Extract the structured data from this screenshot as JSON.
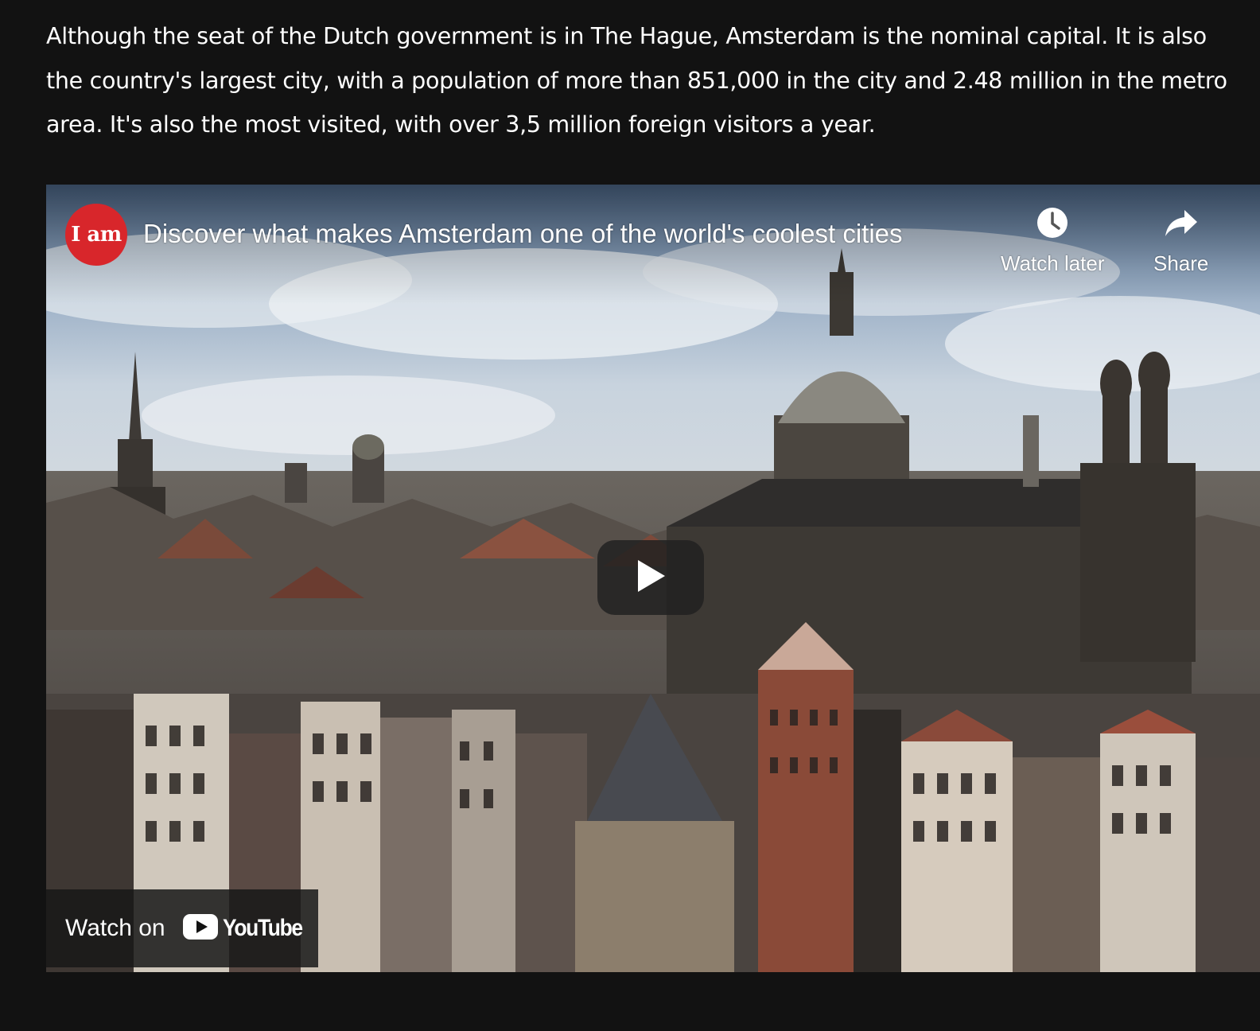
{
  "article": {
    "paragraph": "Although the seat of the Dutch government is in The Hague, Amsterdam is the nominal capital. It is also the country's largest city, with a population of more than 851,000 in the city and 2.48 million in the metro area. It's also the most visited, with over 3,5 million foreign visitors a year."
  },
  "video": {
    "channel_avatar_text": "I am",
    "title": "Discover what makes Amsterdam one of the world's coolest cities",
    "watch_later_label": "Watch later",
    "share_label": "Share",
    "watch_on_label": "Watch on",
    "youtube_wordmark": "YouTube",
    "icons": {
      "watch_later": "clock-icon",
      "share": "share-arrow-icon",
      "play": "play-icon",
      "youtube": "youtube-logo-icon"
    },
    "colors": {
      "avatar_bg": "#d8262b",
      "youtube_red": "#ffffff",
      "page_bg": "#121212"
    }
  }
}
